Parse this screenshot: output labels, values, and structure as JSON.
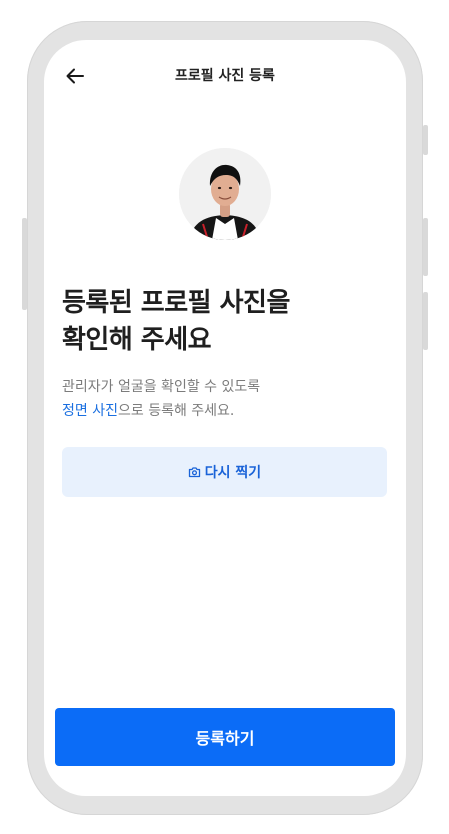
{
  "header": {
    "title": "프로필 사진 등록"
  },
  "headline": {
    "line1": "등록된 프로필 사진을",
    "line2": "확인해 주세요"
  },
  "description": {
    "line1": "관리자가 얼굴을 확인할 수 있도록",
    "highlight": "정면 사진",
    "line2_rest": "으로 등록해 주세요."
  },
  "retake_button": {
    "icon": "camera-icon",
    "label": "다시 찍기"
  },
  "submit_button": {
    "label": "등록하기"
  },
  "colors": {
    "primary": "#0b6cf7",
    "highlight_text": "#1a6fe0",
    "secondary_button_bg": "#e8f1fd"
  }
}
